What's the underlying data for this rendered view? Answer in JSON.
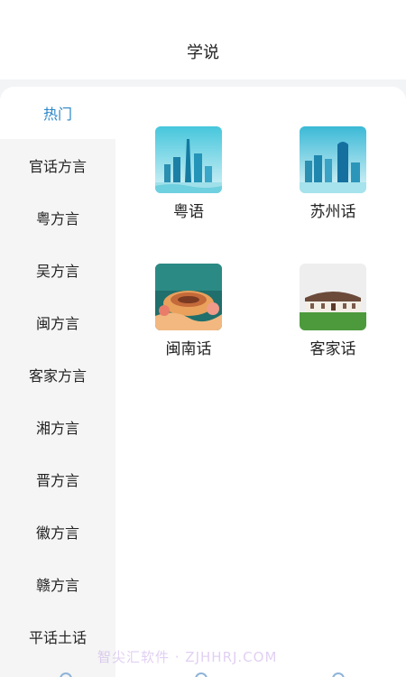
{
  "header": {
    "title": "学说"
  },
  "sidebar": {
    "items": [
      {
        "label": "热门",
        "active": true
      },
      {
        "label": "官话方言"
      },
      {
        "label": "粤方言"
      },
      {
        "label": "吴方言"
      },
      {
        "label": "闽方言"
      },
      {
        "label": "客家方言"
      },
      {
        "label": "湘方言"
      },
      {
        "label": "晋方言"
      },
      {
        "label": "徽方言"
      },
      {
        "label": "赣方言"
      },
      {
        "label": "平话土话"
      }
    ]
  },
  "grid": {
    "items": [
      {
        "label": "粤语",
        "icon": "guangzhou-skyline-thumbnail"
      },
      {
        "label": "苏州话",
        "icon": "suzhou-skyline-thumbnail"
      },
      {
        "label": "闽南话",
        "icon": "tulou-illustration-thumbnail"
      },
      {
        "label": "客家话",
        "icon": "hakka-roundhouse-thumbnail"
      }
    ]
  },
  "watermark": {
    "text": "智尖汇软件 · ZJHHRJ.COM"
  },
  "colors": {
    "accent": "#2a86c8",
    "sidebar_bg": "#f5f5f5",
    "page_bg": "#f3f4f6"
  }
}
